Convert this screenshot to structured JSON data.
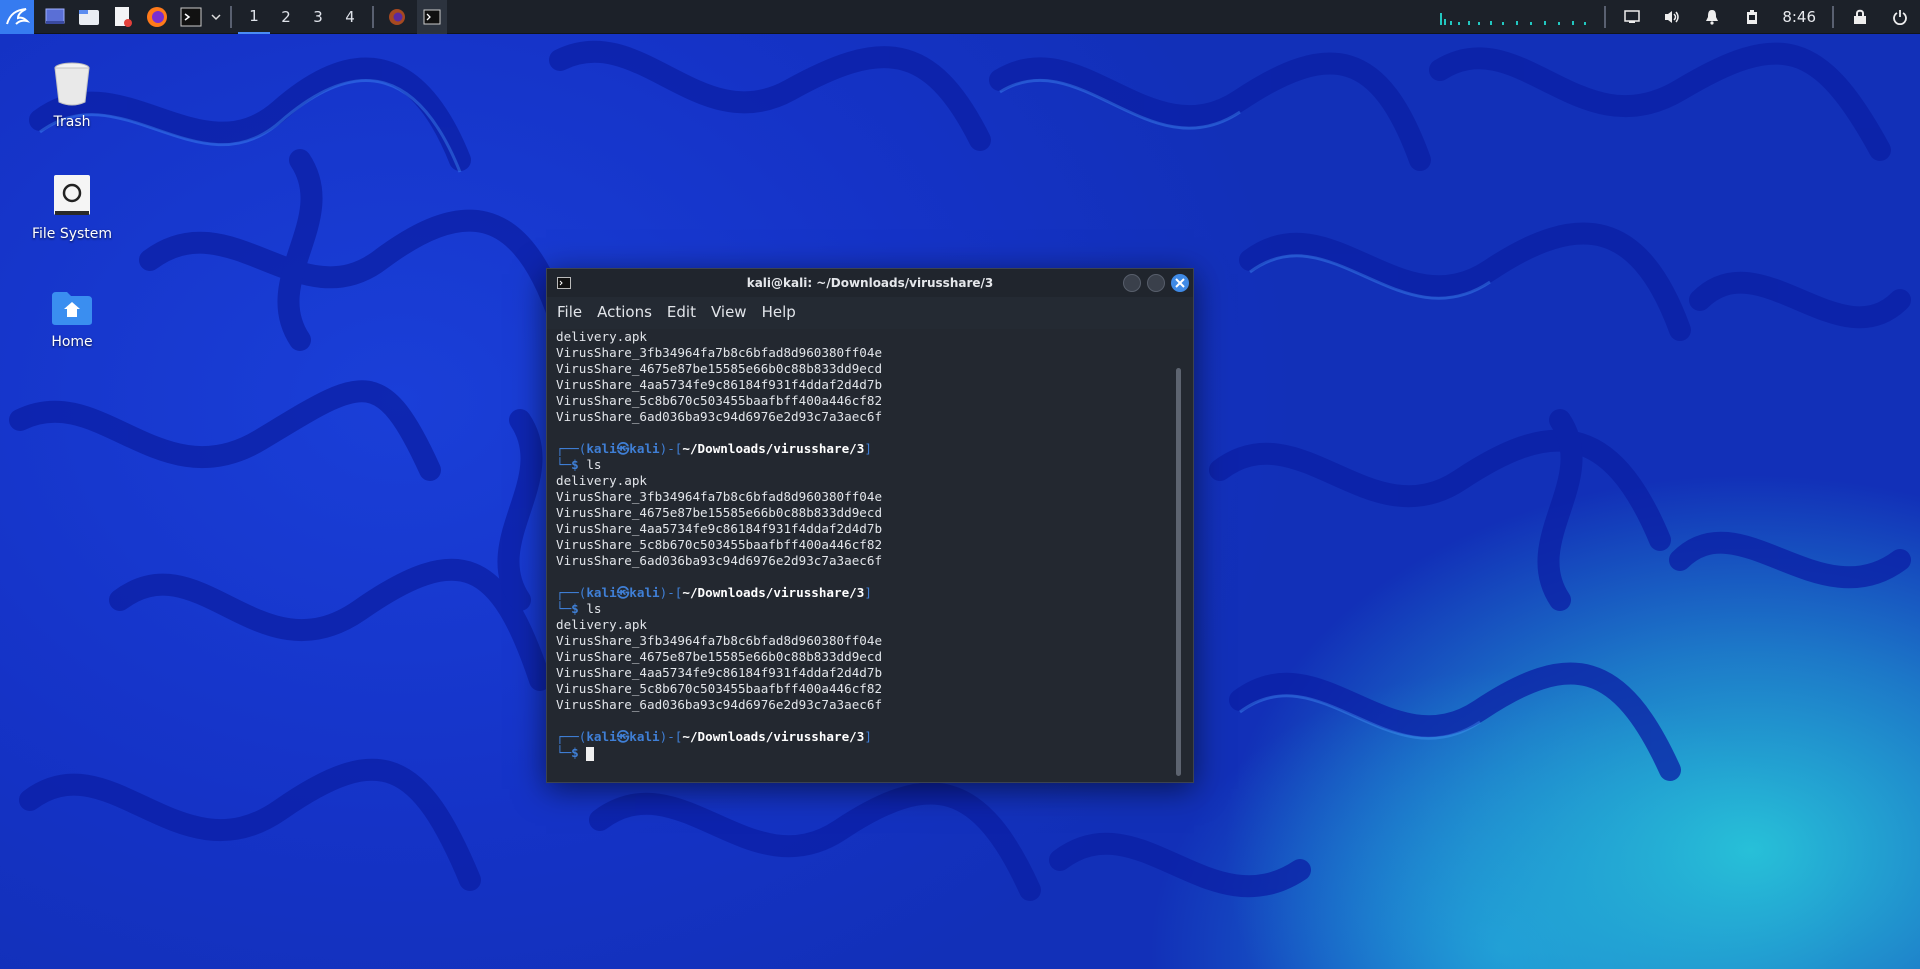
{
  "taskbar": {
    "workspaces": [
      "1",
      "2",
      "3",
      "4"
    ],
    "clock": "8:46"
  },
  "desktop": {
    "icons": [
      {
        "label": "Trash"
      },
      {
        "label": "File System"
      },
      {
        "label": "Home"
      }
    ]
  },
  "window": {
    "title": "kali@kali: ~/Downloads/virusshare/3",
    "menu": [
      "File",
      "Actions",
      "Edit",
      "View",
      "Help"
    ]
  },
  "terminal": {
    "prompt_user": "kali",
    "prompt_at": "㉿",
    "prompt_host": "kali",
    "prompt_path": "~/Downloads/virusshare/3",
    "command": "ls",
    "files": [
      "delivery.apk",
      "VirusShare_3fb34964fa7b8c6bfad8d960380ff04e",
      "VirusShare_4675e87be15585e66b0c88b833dd9ecd",
      "VirusShare_4aa5734fe9c86184f931f4ddaf2d4d7b",
      "VirusShare_5c8b670c503455baafbff400a446cf82",
      "VirusShare_6ad036ba93c94d6976e2d93c7a3aec6f"
    ]
  },
  "colors": {
    "accent": "#367bf0",
    "prompt_blue": "#3f7fd6",
    "terminal_bg": "#232830"
  }
}
